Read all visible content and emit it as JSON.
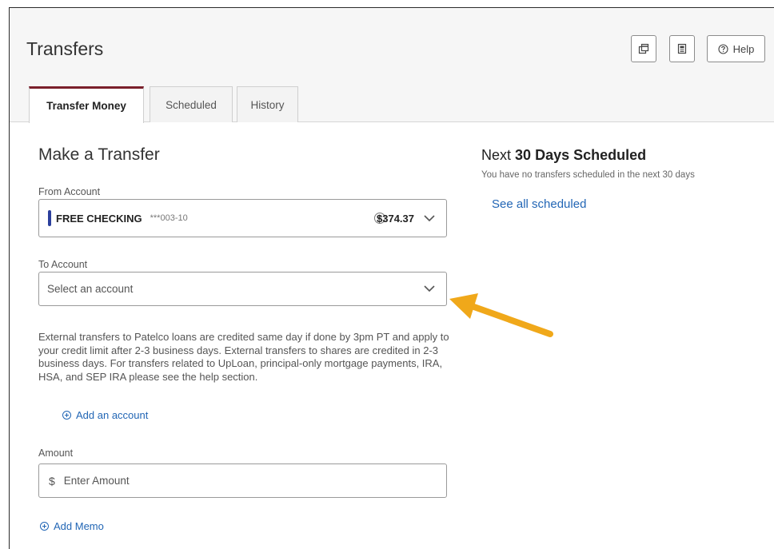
{
  "header": {
    "title": "Transfers",
    "help_label": "Help",
    "tool_icons": [
      "new-window-icon",
      "print-icon",
      "help-circle-icon"
    ]
  },
  "tabs": [
    {
      "label": "Transfer Money",
      "active": true
    },
    {
      "label": "Scheduled",
      "active": false
    },
    {
      "label": "History",
      "active": false
    }
  ],
  "form": {
    "title": "Make a Transfer",
    "from_label": "From Account",
    "from_account": {
      "name": "FREE CHECKING",
      "number": "***003-10",
      "available_badge": "A",
      "balance": "$374.37"
    },
    "to_label": "To Account",
    "to_placeholder": "Select an account",
    "info_text": "External transfers to Patelco loans are credited same day if done by 3pm PT and apply to your credit limit after 2-3 business days. External transfers to shares are credited in 2-3 business days. For transfers related to UpLoan, principal-only mortgage payments, IRA, HSA, and SEP IRA please see the help section.",
    "add_account_label": "Add an account",
    "amount_label": "Amount",
    "currency_symbol": "$",
    "amount_placeholder": "Enter Amount",
    "add_memo_label": "Add Memo"
  },
  "scheduled_panel": {
    "title_prefix": "Next",
    "title_number": "30",
    "title_suffix": "Days Scheduled",
    "subtitle": "You have no transfers scheduled in the next 30 days",
    "see_all_label": "See all scheduled"
  },
  "colors": {
    "accent_tab": "#7a1f2b",
    "account_bar": "#2b3f9c",
    "link": "#2266b5",
    "annotation_arrow": "#f0a81a"
  }
}
